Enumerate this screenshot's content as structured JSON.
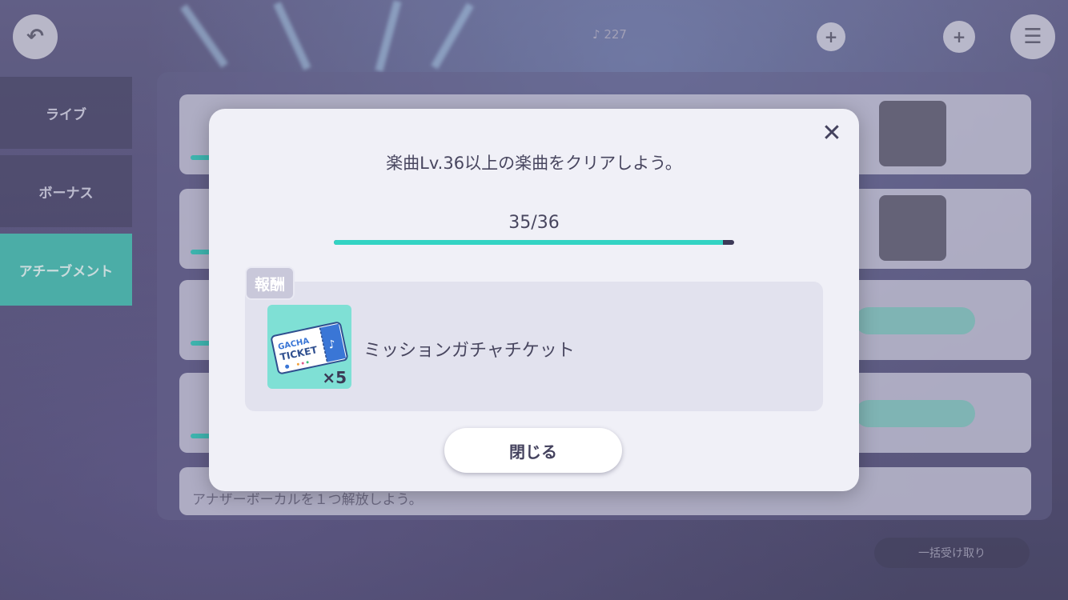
{
  "background": {
    "side_tabs": [
      "ライブ",
      "ボーナス",
      "アチーブメント"
    ],
    "row_text": "アナザーボーカルを１つ解放しよう。",
    "hud": {
      "currency_1": "227",
      "currency_2": "",
      "currency_3": ""
    },
    "bottom_button": "一括受け取り"
  },
  "modal": {
    "close_label": "✕",
    "mission_text": "楽曲Lv.36以上の楽曲をクリアしよう。",
    "progress": {
      "label": "35/36",
      "current": 35,
      "target": 36
    },
    "reward_tag": "報酬",
    "reward": {
      "icon_text_line1": "GACHA",
      "icon_text_line2": "TICKET",
      "quantity": "×5",
      "name": "ミッションガチャチケット"
    },
    "ok_button": "閉じる"
  },
  "colors": {
    "accent_teal": "#33d3c3",
    "track_dark": "#3d3a58",
    "text_dark": "#48465f"
  }
}
